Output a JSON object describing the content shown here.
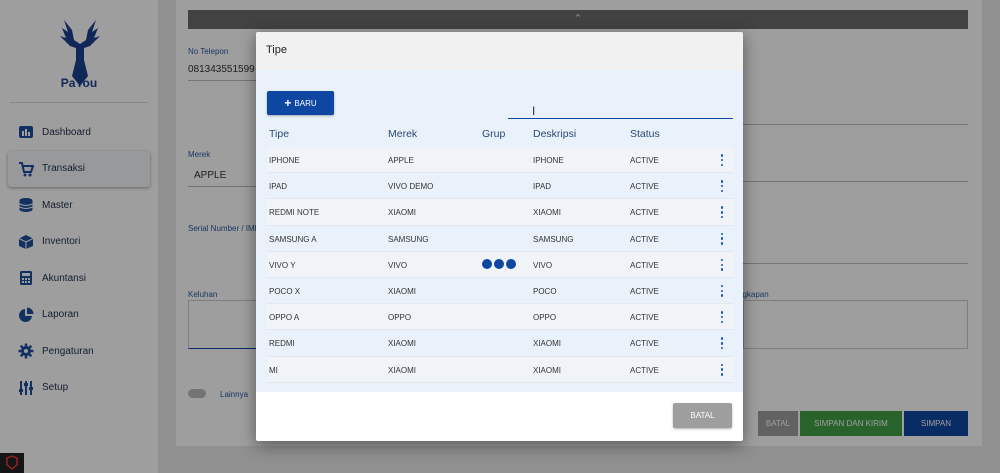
{
  "sidebar": {
    "brand": "PaYou",
    "items": [
      {
        "label": "Dashboard",
        "icon": "dashboard-icon",
        "active": false
      },
      {
        "label": "Transaksi",
        "icon": "cart-icon",
        "active": true
      },
      {
        "label": "Master",
        "icon": "database-icon",
        "active": false
      },
      {
        "label": "Inventori",
        "icon": "box-icon",
        "active": false
      },
      {
        "label": "Akuntansi",
        "icon": "calculator-icon",
        "active": false
      },
      {
        "label": "Laporan",
        "icon": "pie-chart-icon",
        "active": false
      },
      {
        "label": "Pengaturan",
        "icon": "gear-icon",
        "active": false
      },
      {
        "label": "Setup",
        "icon": "sliders-icon",
        "active": false
      }
    ]
  },
  "form": {
    "collapse_icon": "chevron-up-icon",
    "phone_label": "No Telepon",
    "phone_value": "081343551599",
    "brand_label": "Merek",
    "brand_value": "APPLE",
    "serial_label": "Serial Number / IMEI",
    "complaint_label": "Keluhan",
    "completeness_label": "Kelengkapan",
    "other_label": "Lainnya",
    "buttons": {
      "cancel": "BATAL",
      "save_send": "SIMPAN DAN KIRIM",
      "save": "SIMPAN"
    }
  },
  "modal": {
    "title": "Tipe",
    "new_button": "BARU",
    "search_value": "",
    "columns": [
      "Tipe",
      "Merek",
      "Grup",
      "Deskripsi",
      "Status"
    ],
    "rows": [
      {
        "tipe": "IPHONE",
        "merek": "APPLE",
        "grup": "",
        "deskripsi": "IPHONE",
        "status": "ACTIVE"
      },
      {
        "tipe": "IPAD",
        "merek": "VIVO DEMO",
        "grup": "",
        "deskripsi": "IPAD",
        "status": "ACTIVE"
      },
      {
        "tipe": "REDMI NOTE",
        "merek": "XIAOMI",
        "grup": "",
        "deskripsi": "XIAOMI",
        "status": "ACTIVE"
      },
      {
        "tipe": "SAMSUNG A",
        "merek": "SAMSUNG",
        "grup": "",
        "deskripsi": "SAMSUNG",
        "status": "ACTIVE"
      },
      {
        "tipe": "VIVO Y",
        "merek": "VIVO",
        "grup": "",
        "deskripsi": "VIVO",
        "status": "ACTIVE"
      },
      {
        "tipe": "POCO X",
        "merek": "XIAOMI",
        "grup": "",
        "deskripsi": "POCO",
        "status": "ACTIVE"
      },
      {
        "tipe": "OPPO A",
        "merek": "OPPO",
        "grup": "",
        "deskripsi": "OPPO",
        "status": "ACTIVE"
      },
      {
        "tipe": "REDMI",
        "merek": "XIAOMI",
        "grup": "",
        "deskripsi": "XIAOMI",
        "status": "ACTIVE"
      },
      {
        "tipe": "MI",
        "merek": "XIAOMI",
        "grup": "",
        "deskripsi": "XIAOMI",
        "status": "ACTIVE"
      }
    ],
    "cancel_button": "BATAL"
  },
  "colors": {
    "primary": "#0d47a1",
    "success": "#43a047",
    "muted": "#9e9e9e"
  }
}
